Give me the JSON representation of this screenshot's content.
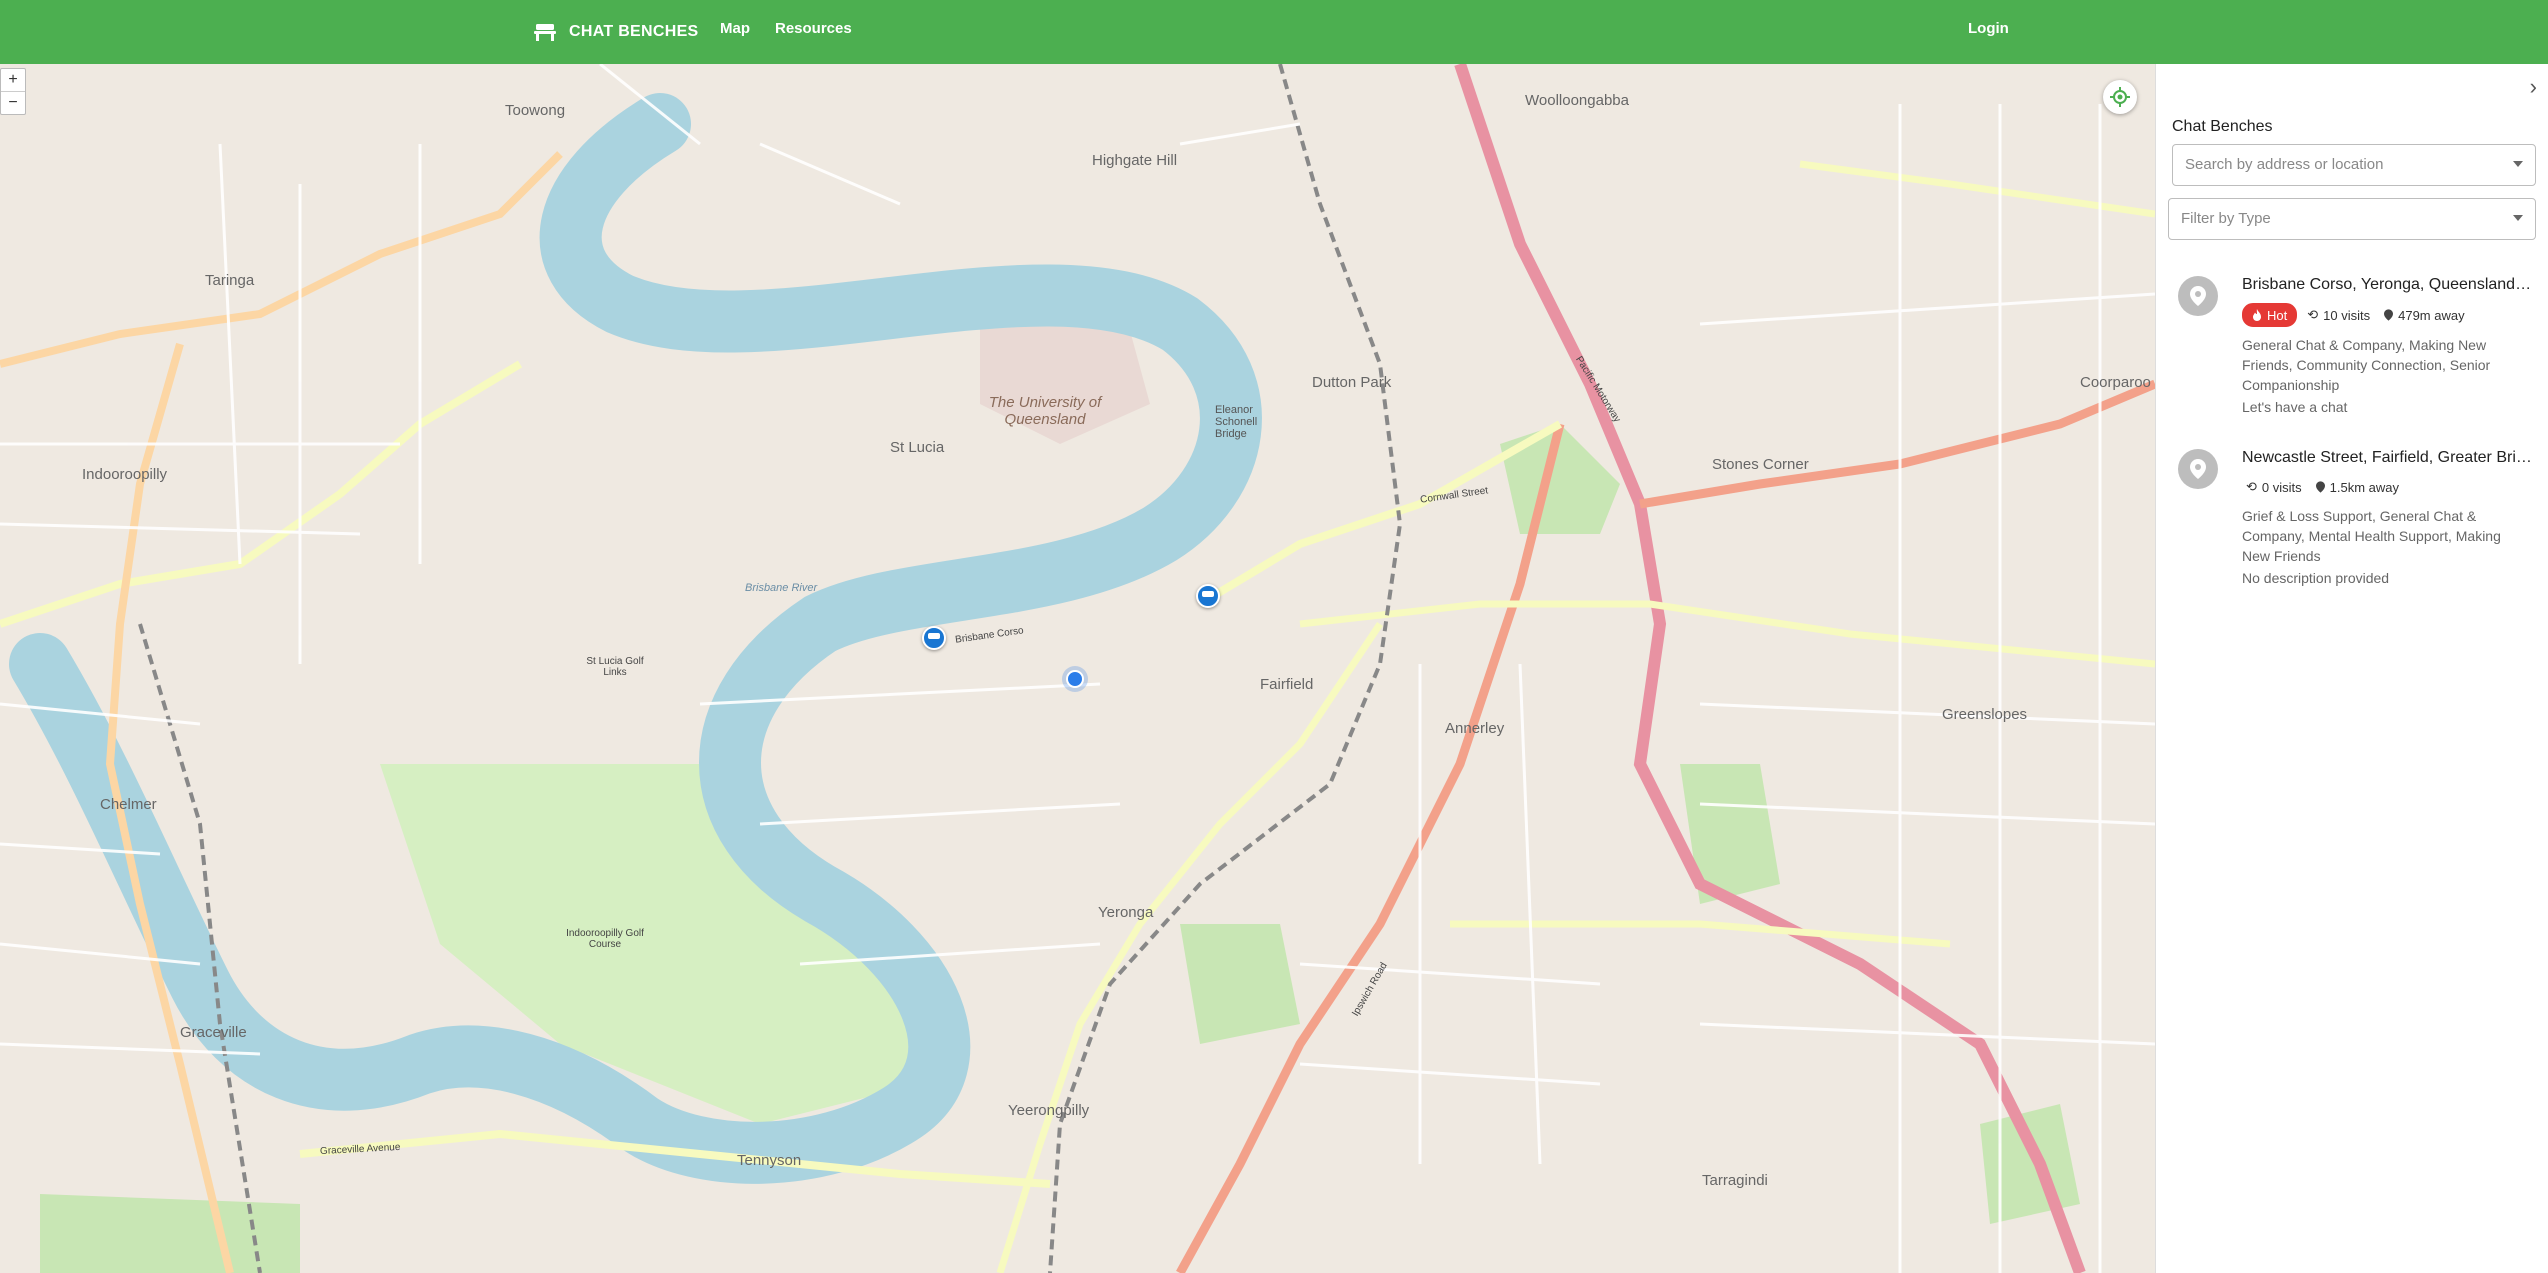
{
  "header": {
    "brand": "CHAT BENCHES",
    "nav": {
      "map": "Map",
      "resources": "Resources",
      "login": "Login"
    },
    "accent": "#4caf50"
  },
  "map": {
    "zoom_in": "+",
    "zoom_out": "−",
    "labels": {
      "toowong": "Toowong",
      "taringa": "Taringa",
      "indooroopilly": "Indooroopilly",
      "st_lucia": "St Lucia",
      "uq": "The University of Queensland",
      "highgate_hill": "Highgate Hill",
      "dutton_park": "Dutton Park",
      "woolloongabba": "Woolloongabba",
      "fairfield": "Fairfield",
      "yeronga": "Yeronga",
      "yeerongpilly": "Yeerongpilly",
      "annerley": "Annerley",
      "greenslopes": "Greenslopes",
      "stones_corner": "Stones Corner",
      "coorparoo": "Coorparoo",
      "chelmer": "Chelmer",
      "graceville": "Graceville",
      "tennyson": "Tennyson",
      "tarragindi": "Tarragindi",
      "brisbane_river": "Brisbane River",
      "eleanor_bridge": "Eleanor Schonell Bridge",
      "pacific_motorway": "Pacific Motorway",
      "brisbane_corso": "Brisbane Corso",
      "ipswich_road": "Ipswich Road",
      "graceville_avenue": "Graceville Avenue",
      "cornwall_street": "Cornwall Street",
      "indooroopilly_golf": "Indooroopilly Golf Course",
      "st_lucia_golf": "St Lucia Golf Links"
    }
  },
  "sidebar": {
    "title": "Chat Benches",
    "search_placeholder": "Search by address or location",
    "filter_placeholder": "Filter by Type",
    "benches": [
      {
        "title": "Brisbane Corso, Yeronga, Queensland, Australia",
        "hot": "Hot",
        "visits": "10 visits",
        "distance": "479m away",
        "tags": "General Chat & Company, Making New Friends, Community Connection, Senior Companionship",
        "description": "Let's have a chat"
      },
      {
        "title": "Newcastle Street, Fairfield, Greater Brisbane, Queensland",
        "visits": "0 visits",
        "distance": "1.5km away",
        "tags": "Grief & Loss Support, General Chat & Company, Mental Health Support, Making New Friends",
        "description": "No description provided"
      }
    ]
  }
}
